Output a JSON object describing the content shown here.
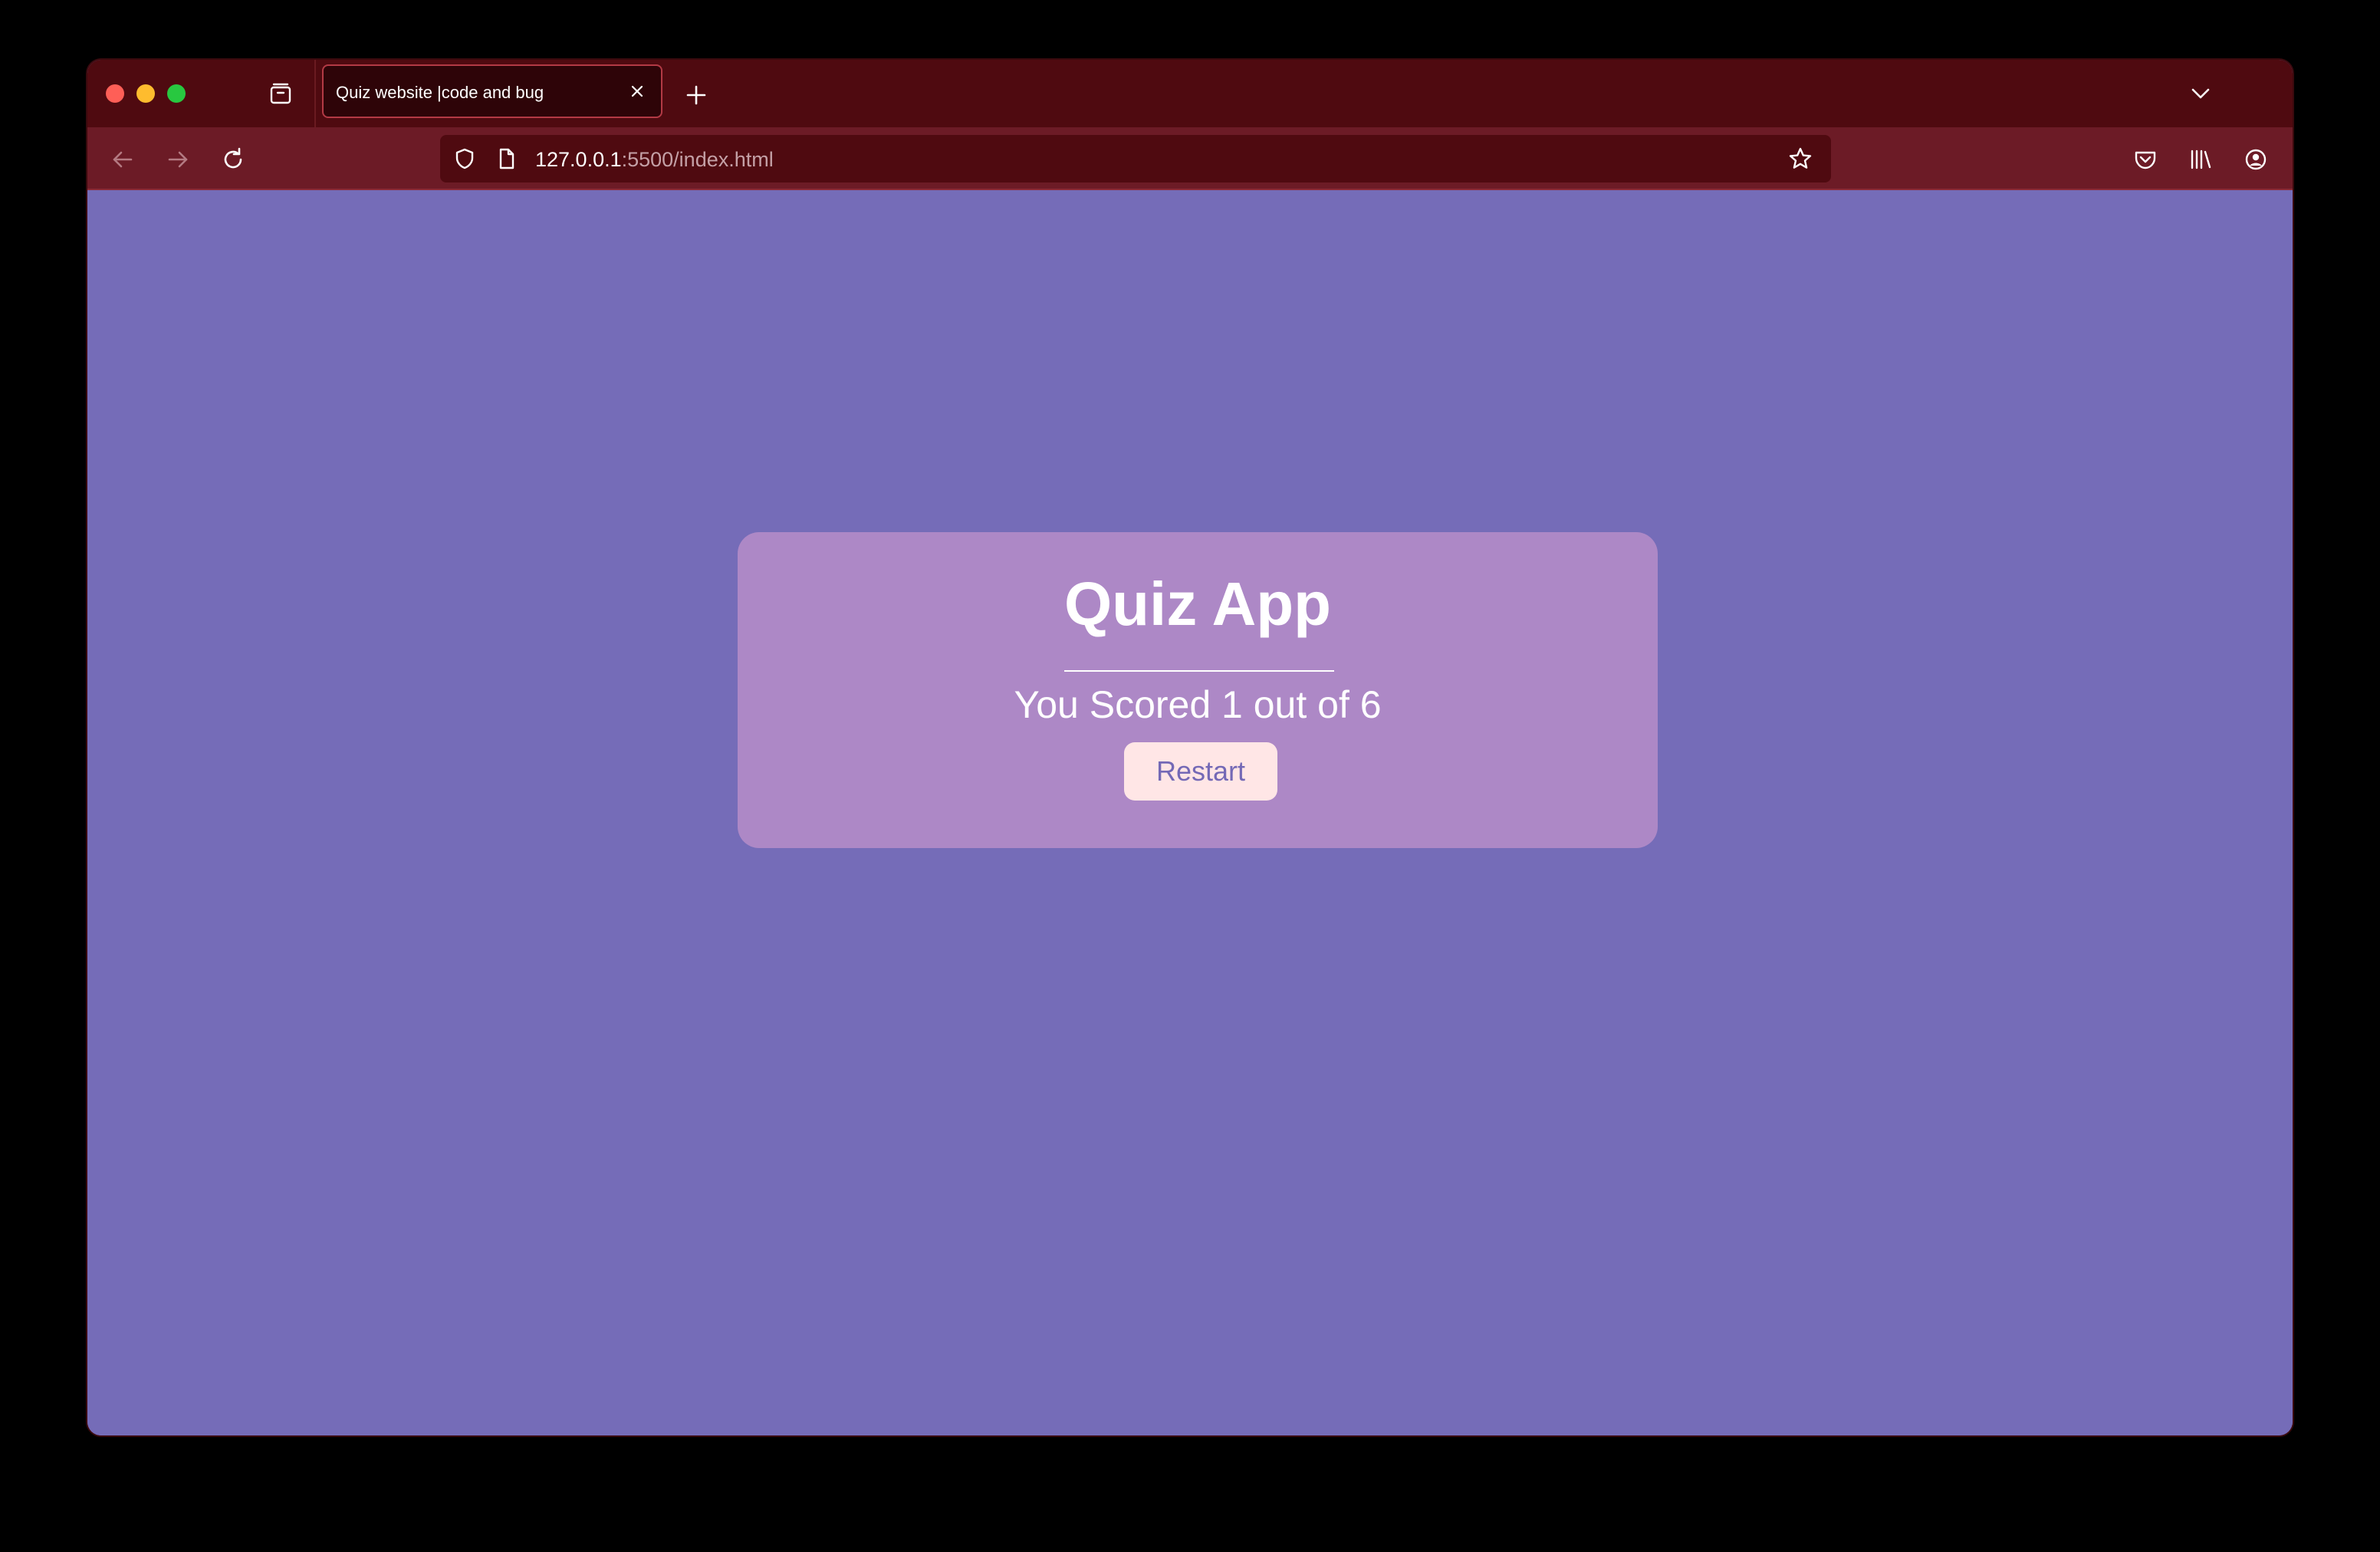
{
  "browser": {
    "tab": {
      "title": "Quiz website |code and bug"
    },
    "address": {
      "host": "127.0.0.1",
      "path": ":5500/index.html"
    },
    "icons": [
      "close-window-icon",
      "minimize-window-icon",
      "maximize-window-icon",
      "tab-overview-icon",
      "close-tab-icon",
      "new-tab-icon",
      "chevron-down-icon",
      "back-icon",
      "forward-icon",
      "reload-icon",
      "shield-icon",
      "page-icon",
      "star-icon",
      "pocket-icon",
      "library-icon",
      "account-icon",
      "extensions-icon",
      "menu-icon"
    ]
  },
  "quiz": {
    "title": "Quiz App",
    "score_text": "You Scored 1 out of 6",
    "restart_label": "Restart"
  },
  "colors": {
    "tab_strip": "#4f0a10",
    "toolbar": "#6c1b26",
    "page_background": "#756cb8",
    "card_background": "#ad88c6",
    "button_background": "#ffe6e6",
    "button_text": "#7469b6"
  }
}
